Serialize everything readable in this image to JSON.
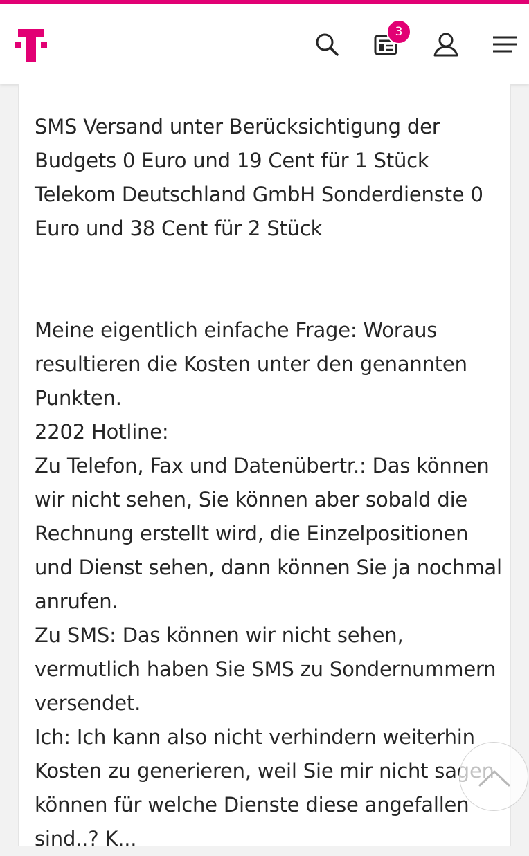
{
  "header": {
    "logo": "telekom-t-logo",
    "icons": [
      "search-icon",
      "news-icon",
      "user-icon",
      "menu-icon"
    ],
    "notification_count": "3"
  },
  "colors": {
    "brand": "#e20074",
    "text": "#262626",
    "background": "#f2f2f2"
  },
  "post": {
    "lines_block1": [
      "SMS Versand unter Berücksichtigung der",
      "Budgets 0 Euro und 19 Cent für 1 Stück",
      "Telekom Deutschland GmbH Sonderdienste 0",
      "Euro und 38 Cent für 2 Stück"
    ],
    "lines_block2": [
      "Meine eigentlich einfache Frage: Woraus",
      "resultieren die Kosten unter den genannten",
      "Punkten.",
      "2202 Hotline:",
      "Zu Telefon, Fax und Datenübertr.: Das können",
      "wir nicht sehen, Sie können aber sobald die",
      "Rechnung erstellt wird, die Einzelpositionen",
      "und Dienst sehen, dann können Sie ja nochmal",
      "anrufen.",
      "Zu SMS: Das können wir nicht sehen,",
      "vermutlich haben Sie SMS zu Sondernummern",
      "versendet.",
      "Ich: Ich kann also nicht verhindern weiterhin",
      "Kosten zu generieren, weil Sie mir nicht sagen",
      "können für welche Dienste diese angefallen",
      "sind..? K..."
    ]
  },
  "scroll_top": {
    "icon": "chevron-up-icon"
  }
}
